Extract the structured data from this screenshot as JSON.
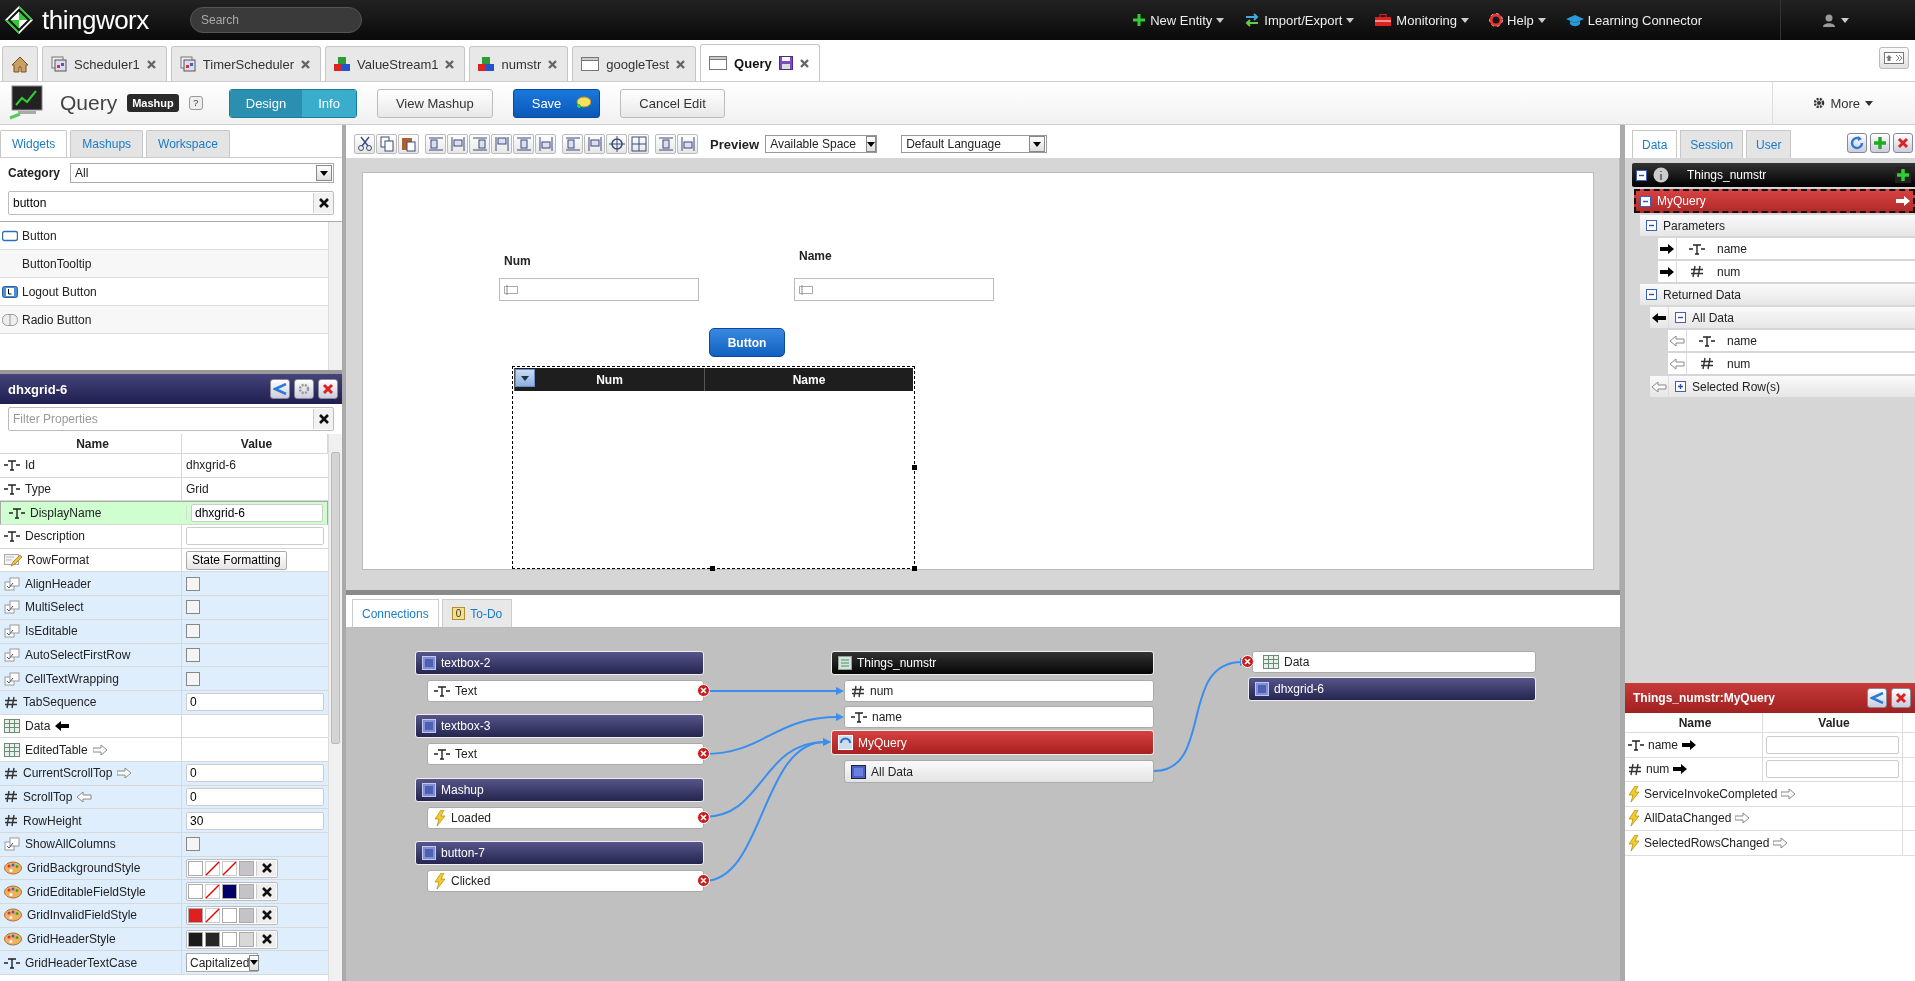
{
  "top_bar": {
    "logo": "thingworx",
    "search": {
      "placeholder": "Search"
    },
    "menus": [
      {
        "label": "New Entity",
        "dropdown": true
      },
      {
        "label": "Import/Export",
        "dropdown": true
      },
      {
        "label": "Monitoring",
        "dropdown": true
      },
      {
        "label": "Help",
        "dropdown": true
      },
      {
        "label": "Learning Connector",
        "dropdown": false
      }
    ]
  },
  "tabs": [
    {
      "label": "Scheduler1",
      "kind": "scheduler",
      "selected": false,
      "modified": false
    },
    {
      "label": "TimerScheduler",
      "kind": "scheduler",
      "selected": false,
      "modified": false
    },
    {
      "label": "ValueStream1",
      "kind": "thing",
      "selected": false,
      "modified": false
    },
    {
      "label": "numstr",
      "kind": "thing",
      "selected": false,
      "modified": false
    },
    {
      "label": "googleTest",
      "kind": "mashup",
      "selected": false,
      "modified": false
    },
    {
      "label": "Query",
      "kind": "mashup",
      "selected": true,
      "modified": true
    }
  ],
  "header": {
    "title": "Query",
    "badge": "Mashup",
    "help": "?",
    "modes": [
      {
        "label": "Design",
        "selected": true
      },
      {
        "label": "Info",
        "selected": false
      }
    ],
    "buttons": [
      {
        "label": "View Mashup",
        "kind": "plain"
      },
      {
        "label": "Save",
        "kind": "primary"
      },
      {
        "label": "Cancel Edit",
        "kind": "plain"
      }
    ],
    "more": "More"
  },
  "widget_tabs": [
    {
      "label": "Widgets",
      "selected": true
    },
    {
      "label": "Mashups",
      "selected": false
    },
    {
      "label": "Workspace",
      "selected": false
    }
  ],
  "category": {
    "label": "Category",
    "value": "All"
  },
  "widget_search": {
    "value": "button"
  },
  "widgets": [
    {
      "label": "Button",
      "kind": "button"
    },
    {
      "label": "ButtonTooltip",
      "kind": "plain"
    },
    {
      "label": "Logout Button",
      "kind": "logout"
    },
    {
      "label": "Radio Button",
      "kind": "radio"
    }
  ],
  "properties": {
    "title": "dhxgrid-6",
    "filter": {
      "placeholder": "Filter Properties"
    },
    "columns": [
      "Name",
      "Value"
    ],
    "rows": [
      {
        "name": "Id",
        "kind": "string",
        "value": {
          "kind": "text",
          "text": "dhxgrid-6"
        },
        "shaded": false,
        "selected": false
      },
      {
        "name": "Type",
        "kind": "string",
        "value": {
          "kind": "text",
          "text": "Grid"
        },
        "shaded": false,
        "selected": false
      },
      {
        "name": "DisplayName",
        "kind": "string",
        "value": {
          "kind": "input",
          "text": "dhxgrid-6"
        },
        "shaded": false,
        "selected": true
      },
      {
        "name": "Description",
        "kind": "string",
        "value": {
          "kind": "input"
        },
        "shaded": false,
        "selected": false
      },
      {
        "name": "RowFormat",
        "kind": "format",
        "value": {
          "kind": "button",
          "text": "State Formatting"
        },
        "shaded": false,
        "selected": false
      },
      {
        "name": "AlignHeader",
        "kind": "boolean",
        "value": {
          "kind": "checkbox",
          "checked": false
        },
        "shaded": true,
        "selected": false
      },
      {
        "name": "MultiSelect",
        "kind": "boolean",
        "value": {
          "kind": "checkbox",
          "checked": false
        },
        "shaded": true,
        "selected": false
      },
      {
        "name": "IsEditable",
        "kind": "boolean",
        "value": {
          "kind": "checkbox",
          "checked": false
        },
        "shaded": true,
        "selected": false
      },
      {
        "name": "AutoSelectFirstRow",
        "kind": "boolean",
        "value": {
          "kind": "checkbox",
          "checked": false
        },
        "shaded": true,
        "selected": false
      },
      {
        "name": "CellTextWrapping",
        "kind": "boolean",
        "value": {
          "kind": "checkbox",
          "checked": false
        },
        "shaded": true,
        "selected": false
      },
      {
        "name": "TabSequence",
        "kind": "number",
        "value": {
          "kind": "input",
          "text": "0"
        },
        "shaded": true,
        "selected": false
      },
      {
        "name": "Data",
        "kind": "table",
        "value": {
          "kind": "empty"
        },
        "link": {
          "kind": "left",
          "bound": true
        },
        "shaded": false,
        "selected": false
      },
      {
        "name": "EditedTable",
        "kind": "table",
        "value": {
          "kind": "empty"
        },
        "link": {
          "kind": "right",
          "bound": false
        },
        "shaded": false,
        "selected": false
      },
      {
        "name": "CurrentScrollTop",
        "kind": "number",
        "value": {
          "kind": "input",
          "text": "0"
        },
        "link": {
          "kind": "right",
          "bound": false
        },
        "shaded": true,
        "selected": false
      },
      {
        "name": "ScrollTop",
        "kind": "number",
        "value": {
          "kind": "input",
          "text": "0"
        },
        "link": {
          "kind": "left",
          "bound": false
        },
        "shaded": true,
        "selected": false
      },
      {
        "name": "RowHeight",
        "kind": "number",
        "value": {
          "kind": "input",
          "text": "30"
        },
        "shaded": true,
        "selected": false
      },
      {
        "name": "ShowAllColumns",
        "kind": "boolean",
        "value": {
          "kind": "checkbox",
          "checked": false
        },
        "shaded": true,
        "selected": false
      },
      {
        "name": "GridBackgroundStyle",
        "kind": "style",
        "value": {
          "kind": "style",
          "swatches": [
            {
              "kind": "fill",
              "color": "#ffffff"
            },
            {
              "kind": "none"
            },
            {
              "kind": "none"
            },
            {
              "kind": "fill",
              "color": "#c4c4c8"
            }
          ]
        },
        "shaded": true,
        "selected": false
      },
      {
        "name": "GridEditableFieldStyle",
        "kind": "style",
        "value": {
          "kind": "style",
          "swatches": [
            {
              "kind": "fill",
              "color": "#ffffff"
            },
            {
              "kind": "none"
            },
            {
              "kind": "fill",
              "color": "#000066"
            },
            {
              "kind": "fill",
              "color": "#c4c4c8"
            }
          ]
        },
        "shaded": true,
        "selected": false
      },
      {
        "name": "GridInvalidFieldStyle",
        "kind": "style",
        "value": {
          "kind": "style",
          "swatches": [
            {
              "kind": "fill",
              "color": "#e02020"
            },
            {
              "kind": "none"
            },
            {
              "kind": "fill",
              "color": "#ffffff"
            },
            {
              "kind": "fill",
              "color": "#c4c4c8"
            }
          ]
        },
        "shaded": true,
        "selected": false
      },
      {
        "name": "GridHeaderStyle",
        "kind": "style",
        "value": {
          "kind": "style",
          "swatches": [
            {
              "kind": "fill",
              "color": "#1a1a1a"
            },
            {
              "kind": "fill",
              "color": "#262626"
            },
            {
              "kind": "fill",
              "color": "#ffffff"
            },
            {
              "kind": "fill",
              "color": "#d8d8d8"
            }
          ]
        },
        "shaded": true,
        "selected": false
      },
      {
        "name": "GridHeaderTextCase",
        "kind": "string",
        "value": {
          "kind": "select",
          "text": "Capitalized"
        },
        "shaded": true,
        "selected": false
      }
    ]
  },
  "toolbar": {
    "preview_label": "Preview",
    "preview_select": "Available Space",
    "language_select": "Default Language"
  },
  "canvas": {
    "labels": [
      "Num",
      "Name"
    ],
    "button": "Button",
    "grid_columns": [
      "Num",
      "Name"
    ]
  },
  "bottom_tabs": [
    {
      "label": "Connections",
      "selected": true
    },
    {
      "label": "To-Do",
      "selected": false,
      "count": "0"
    }
  ],
  "connections": {
    "sources": [
      {
        "title": "textbox-2",
        "item": {
          "label": "Text",
          "kind": "string"
        }
      },
      {
        "title": "textbox-3",
        "item": {
          "label": "Text",
          "kind": "string"
        }
      },
      {
        "title": "Mashup",
        "item": {
          "label": "Loaded",
          "kind": "event"
        }
      },
      {
        "title": "button-7",
        "item": {
          "label": "Clicked",
          "kind": "event"
        }
      }
    ],
    "service": {
      "thing": "Things_numstr",
      "params": [
        {
          "label": "num",
          "kind": "number"
        },
        {
          "label": "name",
          "kind": "string"
        }
      ],
      "name": "MyQuery",
      "output": {
        "label": "All Data",
        "kind": "table"
      }
    },
    "target": {
      "property": {
        "label": "Data",
        "kind": "table"
      },
      "widget": "dhxgrid-6"
    }
  },
  "data_tabs": [
    {
      "label": "Data",
      "selected": true
    },
    {
      "label": "Session",
      "selected": false
    },
    {
      "label": "User",
      "selected": false
    }
  ],
  "data_tree": [
    {
      "label": "Things_numstr",
      "kind": "entity",
      "expanded": true,
      "children": [
        {
          "label": "MyQuery",
          "kind": "service",
          "expanded": true,
          "selected": true,
          "link": {
            "kind": "right",
            "bound": true
          },
          "children": [
            {
              "label": "Parameters",
              "kind": "group",
              "expanded": true,
              "children": [
                {
                  "label": "name",
                  "kind": "string",
                  "link": {
                    "kind": "right",
                    "bound": true
                  }
                },
                {
                  "label": "num",
                  "kind": "number",
                  "link": {
                    "kind": "right",
                    "bound": true
                  }
                }
              ]
            },
            {
              "label": "Returned Data",
              "kind": "group",
              "expanded": true,
              "children": [
                {
                  "label": "All Data",
                  "kind": "group",
                  "expanded": true,
                  "link": {
                    "kind": "left",
                    "bound": true
                  },
                  "children": [
                    {
                      "label": "name",
                      "kind": "string",
                      "link": {
                        "kind": "left",
                        "bound": false
                      }
                    },
                    {
                      "label": "num",
                      "kind": "number",
                      "link": {
                        "kind": "left",
                        "bound": false
                      }
                    }
                  ]
                },
                {
                  "label": "Selected Row(s)",
                  "kind": "group",
                  "expanded": false,
                  "link": {
                    "kind": "left",
                    "bound": false
                  }
                }
              ]
            }
          ]
        }
      ]
    }
  ],
  "service_panel": {
    "title": "Things_numstr:MyQuery",
    "columns": [
      "Name",
      "Value"
    ],
    "rows": [
      {
        "label": "name",
        "kind": "string",
        "link": {
          "kind": "right",
          "bound": true
        }
      },
      {
        "label": "num",
        "kind": "number",
        "link": {
          "kind": "right",
          "bound": true
        }
      },
      {
        "label": "ServiceInvokeCompleted",
        "kind": "event",
        "link": {
          "kind": "right",
          "bound": false
        }
      },
      {
        "label": "AllDataChanged",
        "kind": "event",
        "link": {
          "kind": "right",
          "bound": false
        }
      },
      {
        "label": "SelectedRowsChanged",
        "kind": "event",
        "link": {
          "kind": "right",
          "bound": false
        }
      }
    ]
  }
}
